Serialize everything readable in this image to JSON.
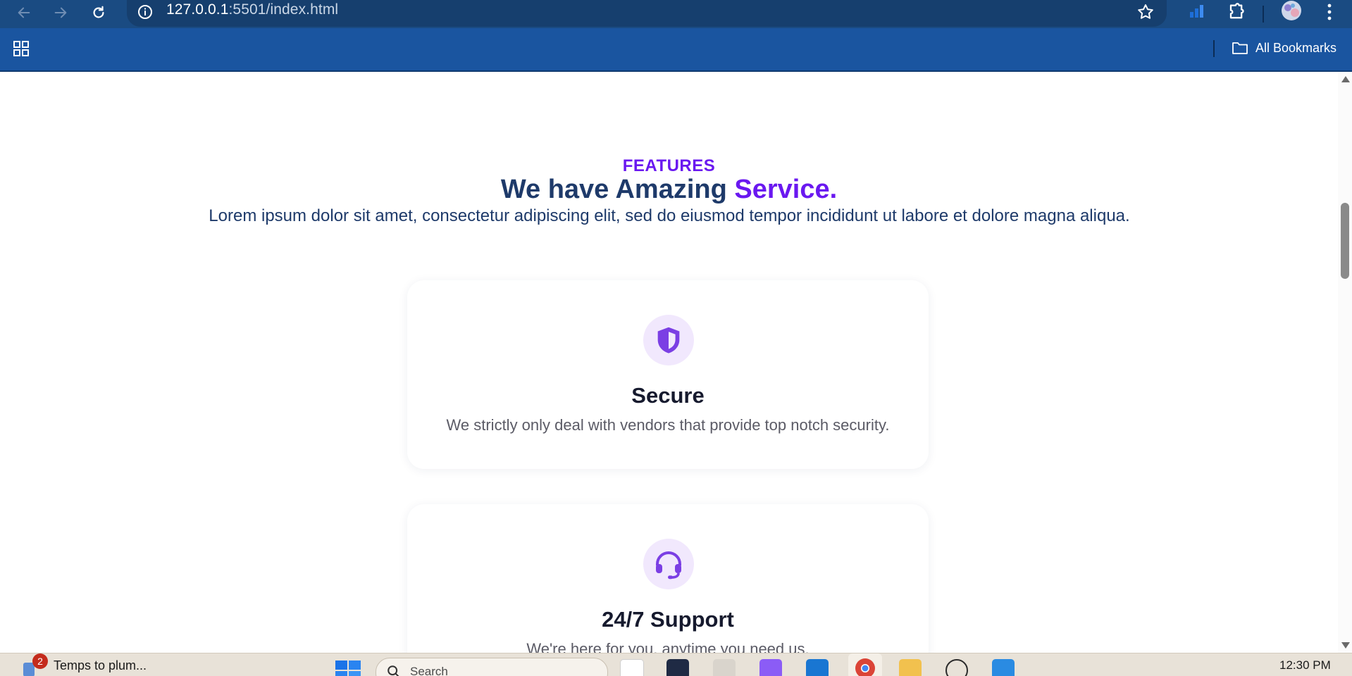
{
  "browser": {
    "url_host": "127.0.0.1",
    "url_rest": ":5501/index.html",
    "bookmarks_label": "All Bookmarks"
  },
  "section": {
    "eyebrow": "FEATURES",
    "headline_main": "We have Amazing",
    "headline_accent": "Service.",
    "lead": "Lorem ipsum dolor sit amet, consectetur adipiscing elit, sed do eiusmod tempor incididunt ut labore et dolore magna aliqua."
  },
  "cards": [
    {
      "icon": "shield-icon",
      "title": "Secure",
      "text": "We strictly only deal with vendors that provide top notch security."
    },
    {
      "icon": "headset-icon",
      "title": "24/7 Support",
      "text": "We're here for you, anytime you need us."
    }
  ],
  "taskbar": {
    "notification_count": "2",
    "app_label": "Temps to plum...",
    "search_placeholder": "Search",
    "clock": "12:30 PM"
  },
  "colors": {
    "accent": "#6a18f0",
    "heading": "#1e3a6a",
    "chrome": "#1a4b82",
    "icon_bg": "#f1e8fd",
    "icon_fg": "#7b3fe4"
  }
}
